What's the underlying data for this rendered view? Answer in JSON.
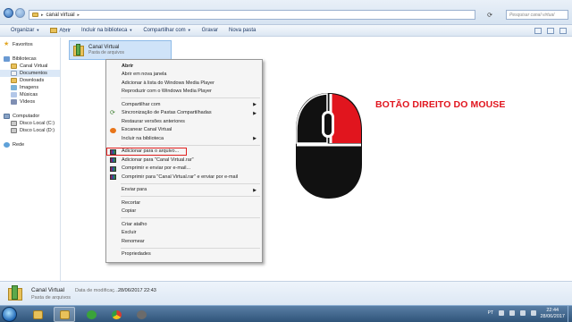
{
  "address_bar": {
    "path": [
      "canal virtual"
    ],
    "search_placeholder": "Pesquisar canal virtual"
  },
  "toolbar": {
    "organize": "Organizar",
    "open": "Abrir",
    "include_library": "Incluir na biblioteca",
    "share": "Compartilhar com",
    "burn": "Gravar",
    "new_folder": "Nova pasta"
  },
  "navpane": {
    "favorites": "Favoritos",
    "libraries": "Bibliotecas",
    "library_items": [
      "Canal Virtual",
      "Documentos",
      "Downloads",
      "Imagens",
      "Músicas",
      "Vídeos"
    ],
    "computer": "Computador",
    "drives": [
      "Disco Local (C:)",
      "Disco Local (D:)"
    ],
    "network": "Rede"
  },
  "selected_file": {
    "name": "Canal Virtual",
    "type": "Pasta de arquivos"
  },
  "context_menu": {
    "items": [
      {
        "label": "Abrir",
        "bold": true
      },
      {
        "label": "Abrir em nova janela"
      },
      {
        "label": "Adicionar à lista do Windows Media Player"
      },
      {
        "label": "Reproduzir com o Windows Media Player"
      },
      {
        "sep": true
      },
      {
        "label": "Compartilhar com",
        "submenu": true
      },
      {
        "label": "Sincronização de Pastas Compartilhadas",
        "submenu": true,
        "icon": "sync-icon"
      },
      {
        "label": "Restaurar versões anteriores"
      },
      {
        "label": "Escanear Canal Virtual",
        "icon": "antivirus-icon"
      },
      {
        "label": "Incluir na biblioteca",
        "submenu": true
      },
      {
        "sep": true
      },
      {
        "label": "Adicionar para o arquivo...",
        "icon": "winrar-icon",
        "highlight": true
      },
      {
        "label": "Adicionar para \"Canal Virtual.rar\"",
        "icon": "winrar-icon"
      },
      {
        "label": "Comprimir e enviar por e-mail...",
        "icon": "winrar-icon"
      },
      {
        "label": "Comprimir para \"Canal Virtual.rar\" e enviar por e-mail",
        "icon": "winrar-icon"
      },
      {
        "sep": true
      },
      {
        "label": "Enviar para",
        "submenu": true
      },
      {
        "sep": true
      },
      {
        "label": "Recortar"
      },
      {
        "label": "Copiar"
      },
      {
        "sep": true
      },
      {
        "label": "Criar atalho"
      },
      {
        "label": "Excluir"
      },
      {
        "label": "Renomear"
      },
      {
        "sep": true
      },
      {
        "label": "Propriedades"
      }
    ]
  },
  "annotation": {
    "caption": "BOTÃO DIREITO DO MOUSE",
    "highlight_color": "#e1151e"
  },
  "details": {
    "name": "Canal Virtual",
    "type": "Pasta de arquivos",
    "modified_label": "Data de modificaç...",
    "modified_value": "28/06/2017 22:43"
  },
  "taskbar": {
    "language": "PT",
    "time": "22:44",
    "date": "28/06/2017"
  }
}
